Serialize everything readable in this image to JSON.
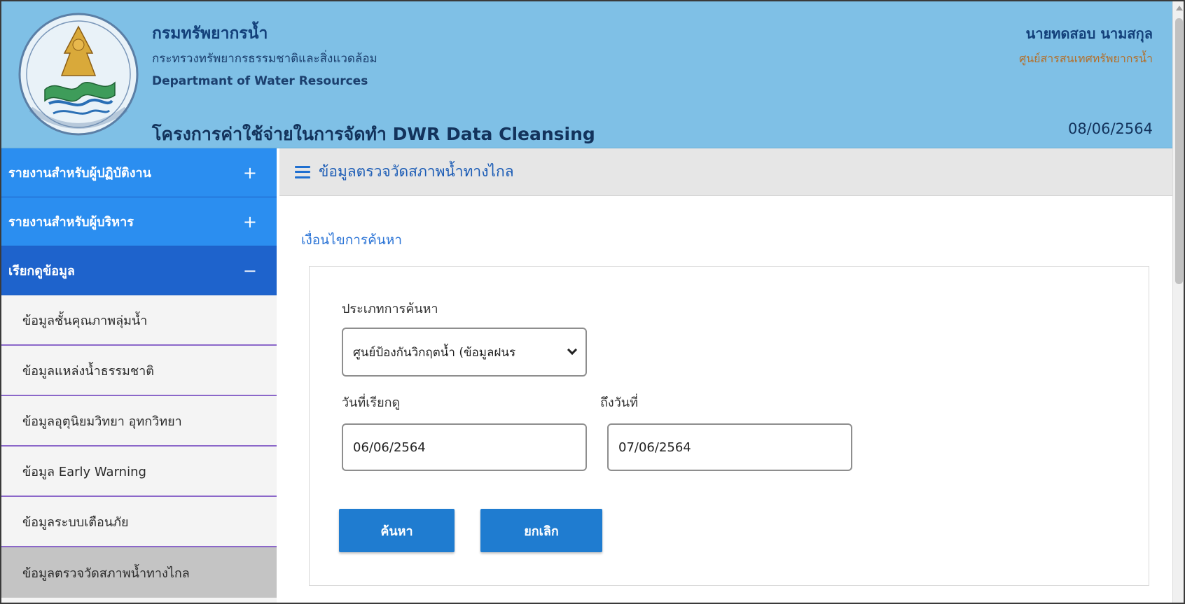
{
  "header": {
    "org_name": "กรมทรัพยากรน้ำ",
    "ministry": "กระทรวงทรัพยากรธรรมชาติและสิ่งแวดล้อม",
    "dept_en": "Departmant of Water Resources",
    "project": "โครงการค่าใช้จ่ายในการจัดทำ DWR Data Cleansing",
    "user_name": "นายทดสอบ นามสกุล",
    "user_unit": "ศูนย์สารสนเทศทรัพยากรน้ำ",
    "date": "08/06/2564"
  },
  "sidebar": {
    "groups": [
      {
        "label": "รายงานสำหรับผู้ปฏิบัติงาน",
        "sign": "+"
      },
      {
        "label": "รายงานสำหรับผู้บริหาร",
        "sign": "+"
      },
      {
        "label": "เรียกดูข้อมูล",
        "sign": "−"
      }
    ],
    "items": [
      {
        "label": "ข้อมูลชั้นคุณภาพลุ่มน้ำ"
      },
      {
        "label": "ข้อมูลแหล่งน้ำธรรมชาติ"
      },
      {
        "label": "ข้อมูลอุตุนิยมวิทยา อุทกวิทยา"
      },
      {
        "label": "ข้อมูล Early Warning"
      },
      {
        "label": "ข้อมูลระบบเตือนภัย"
      },
      {
        "label": "ข้อมูลตรวจวัดสภาพน้ำทางไกล",
        "active": true
      }
    ]
  },
  "main": {
    "title": "ข้อมูลตรวจวัดสภาพน้ำทางไกล",
    "search_caption": "เงื่อนไขการค้นหา",
    "search_type_label": "ประเภทการค้นหา",
    "search_type_value": "ศูนย์ป้องกันวิกฤตน้ำ (ข้อมูลฝนร",
    "start_date_label": "วันที่เรียกดู",
    "start_date_value": "06/06/2564",
    "end_date_label": "ถึงวันที่",
    "end_date_value": "07/06/2564",
    "search_button": "ค้นหา",
    "cancel_button": "ยกเลิก"
  },
  "colors": {
    "header_bg": "#7fc0e6",
    "menu_blue": "#2b8ef0",
    "menu_dark": "#1e63cc",
    "button_blue": "#1f7cd0",
    "active_item": "#c4c4c4",
    "accent_purple": "#8b67c9"
  }
}
